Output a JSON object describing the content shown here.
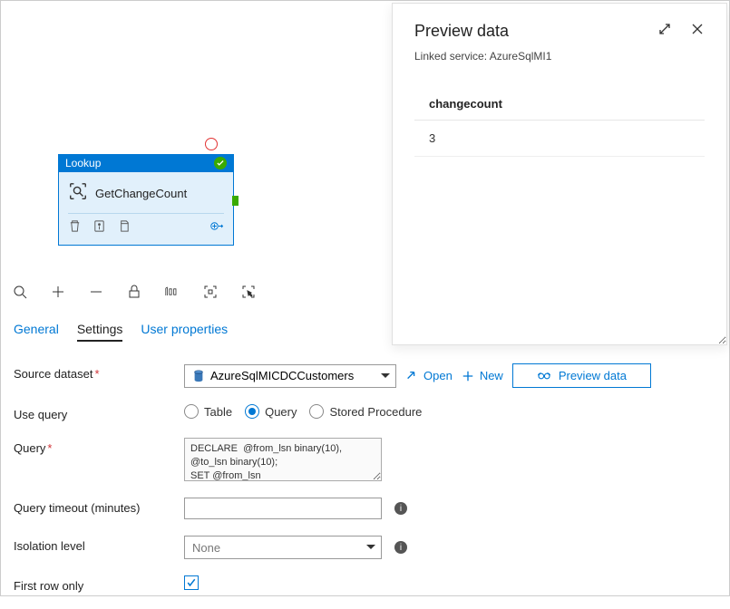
{
  "preview": {
    "title": "Preview data",
    "linked_label": "Linked service:",
    "linked_value": "AzureSqlMI1",
    "columns": [
      "changecount"
    ],
    "rows": [
      [
        "3"
      ]
    ]
  },
  "activity": {
    "type_label": "Lookup",
    "name": "GetChangeCount"
  },
  "tabs": {
    "general": "General",
    "settings": "Settings",
    "user_props": "User properties"
  },
  "form": {
    "source_dataset": {
      "label": "Source dataset",
      "value": "AzureSqlMICDCCustomers"
    },
    "open": "Open",
    "new": "New",
    "preview_data": "Preview data",
    "use_query": {
      "label": "Use query",
      "options": {
        "table": "Table",
        "query": "Query",
        "sproc": "Stored Procedure"
      },
      "selected": "query"
    },
    "query": {
      "label": "Query",
      "value": "DECLARE  @from_lsn binary(10), @to_lsn binary(10);\nSET @from_lsn"
    },
    "query_timeout": {
      "label": "Query timeout (minutes)",
      "value": ""
    },
    "isolation": {
      "label": "Isolation level",
      "value": "None"
    },
    "first_row_only": {
      "label": "First row only",
      "checked": true
    }
  }
}
